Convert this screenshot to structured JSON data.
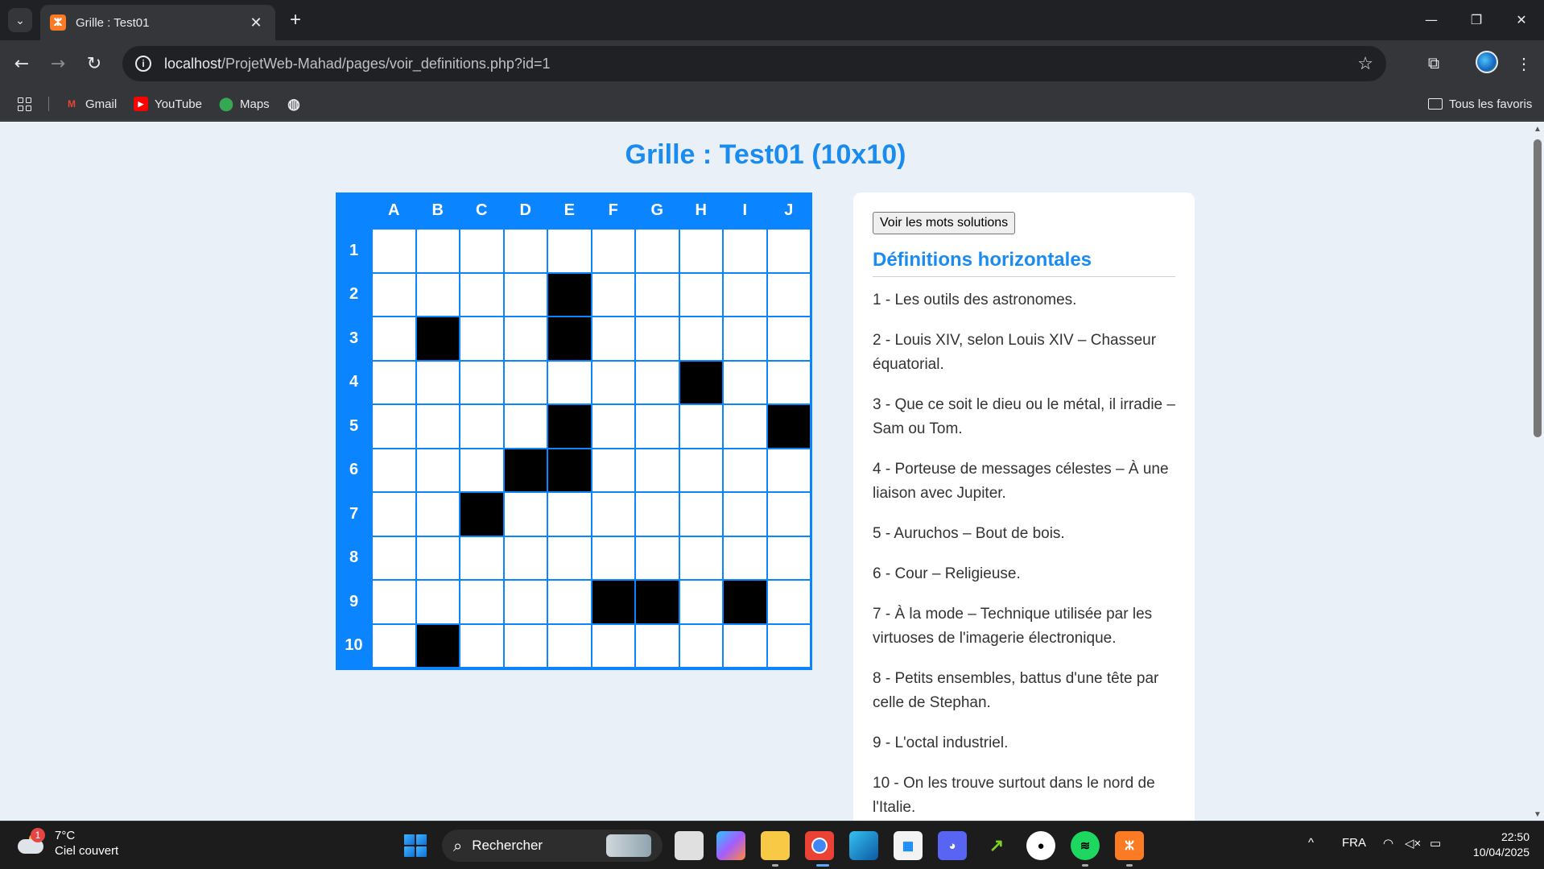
{
  "browser": {
    "tab_title": "Grille : Test01",
    "url_host": "localhost",
    "url_path": "/ProjetWeb-Mahad/pages/voir_definitions.php?id=1",
    "bookmarks": [
      "Gmail",
      "YouTube",
      "Maps"
    ],
    "all_bookmarks": "Tous les favoris"
  },
  "page": {
    "title": "Grille : Test01 (10x10)",
    "grid": {
      "columns": [
        "A",
        "B",
        "C",
        "D",
        "E",
        "F",
        "G",
        "H",
        "I",
        "J"
      ],
      "rows": [
        "1",
        "2",
        "3",
        "4",
        "5",
        "6",
        "7",
        "8",
        "9",
        "10"
      ],
      "black_cells": [
        [
          2,
          5
        ],
        [
          3,
          2
        ],
        [
          3,
          5
        ],
        [
          4,
          8
        ],
        [
          5,
          5
        ],
        [
          5,
          10
        ],
        [
          6,
          4
        ],
        [
          6,
          5
        ],
        [
          7,
          3
        ],
        [
          9,
          6
        ],
        [
          9,
          7
        ],
        [
          9,
          9
        ],
        [
          10,
          2
        ]
      ]
    },
    "solutions_button": "Voir les mots solutions",
    "definitions_heading": "Définitions horizontales",
    "definitions": [
      "1 - Les outils des astronomes.",
      "2 - Louis XIV, selon Louis XIV – Chasseur équatorial.",
      "3 - Que ce soit le dieu ou le métal, il irradie – Sam ou Tom.",
      "4 - Porteuse de messages célestes – À une liaison avec Jupiter.",
      "5 - Auruchos – Bout de bois.",
      "6 - Cour – Religieuse.",
      "7 - À la mode – Technique utilisée par les virtuoses de l'imagerie électronique.",
      "8 - Petits ensembles, battus d'une tête par celle de Stephan.",
      "9 - L'octal industriel.",
      "10 - On les trouve surtout dans le nord de l'Italie."
    ],
    "colors": {
      "accent": "#1a8cf0",
      "grid_blue": "#0a84ff",
      "background": "#eaf0f8"
    }
  },
  "taskbar": {
    "weather_temp": "7°C",
    "weather_desc": "Ciel couvert",
    "weather_badge": "1",
    "search_label": "Rechercher",
    "language": "FRA",
    "time": "22:50",
    "date": "10/04/2025"
  }
}
